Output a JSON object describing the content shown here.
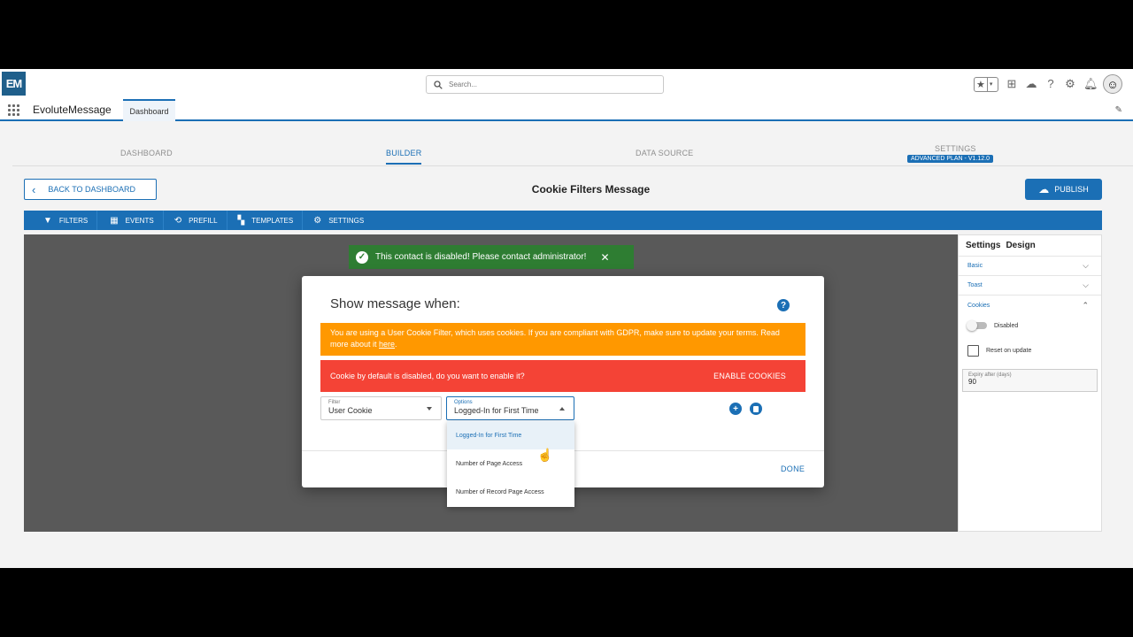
{
  "header": {
    "logo_text": "EM",
    "search_placeholder": "Search...",
    "icons": [
      "favorites-star-icon",
      "add-icon",
      "trailhead-icon",
      "help-icon",
      "settings-gear-icon",
      "notifications-bell-icon",
      "user-avatar"
    ]
  },
  "appbar": {
    "app_name": "EvoluteMessage",
    "tab_label": "Dashboard"
  },
  "steps": {
    "dashboard": "DASHBOARD",
    "builder": "BUILDER",
    "data_source": "DATA SOURCE",
    "settings": "SETTINGS",
    "plan_badge": "ADVANCED PLAN - V1.12.0"
  },
  "builder": {
    "back_label": "BACK TO DASHBOARD",
    "title": "Cookie Filters Message",
    "publish_label": "PUBLISH"
  },
  "toolbar": {
    "filters": "FILTERS",
    "events": "EVENTS",
    "prefill": "PREFILL",
    "templates": "TEMPLATES",
    "settings": "SETTINGS"
  },
  "right_panel": {
    "tab_settings": "Settings",
    "tab_design": "Design",
    "basic": "Basic",
    "toast": "Toast",
    "cookies": "Cookies",
    "disabled_label": "Disabled",
    "reset_label": "Reset on update",
    "expiry_label": "Expiry after (days)",
    "expiry_value": "90"
  },
  "toast": {
    "message": "This contact is disabled! Please contact administrator!"
  },
  "modal": {
    "title": "Show message when:",
    "warning_text": "You are using a User Cookie Filter, which uses cookies. If you are compliant with GDPR, make sure to update your terms. Read more about it ",
    "warning_link": "here",
    "warning_end": ".",
    "error_text": "Cookie by default is disabled, do you want to enable it?",
    "enable_label": "ENABLE COOKIES",
    "filter_label": "Filter",
    "filter_value": "User Cookie",
    "options_label": "Options",
    "options_value": "Logged-In for First Time",
    "done_label": "DONE"
  },
  "dropdown": {
    "options": [
      "Logged-In for First Time",
      "Number of Page Access",
      "Number of Record Page Access"
    ],
    "selected_index": 0
  },
  "colors": {
    "brand_blue": "#1b6fb5",
    "warning": "#ff9800",
    "error": "#f44336",
    "success": "#2e7d32"
  }
}
